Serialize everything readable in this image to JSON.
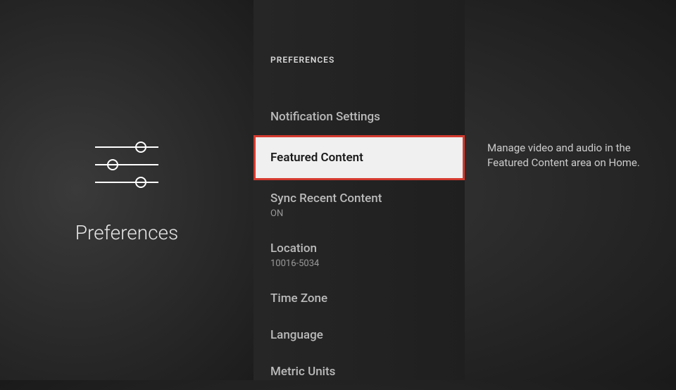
{
  "left": {
    "title": "Preferences"
  },
  "middle": {
    "heading": "PREFERENCES",
    "items": [
      {
        "label": "Notification Settings",
        "sub": "",
        "selected": false
      },
      {
        "label": "Featured Content",
        "sub": "",
        "selected": true
      },
      {
        "label": "Sync Recent Content",
        "sub": "ON",
        "selected": false
      },
      {
        "label": "Location",
        "sub": "10016-5034",
        "selected": false
      },
      {
        "label": "Time Zone",
        "sub": "",
        "selected": false
      },
      {
        "label": "Language",
        "sub": "",
        "selected": false
      },
      {
        "label": "Metric Units",
        "sub": "",
        "selected": false
      }
    ]
  },
  "right": {
    "description": "Manage video and audio in the Featured Content area on Home."
  }
}
